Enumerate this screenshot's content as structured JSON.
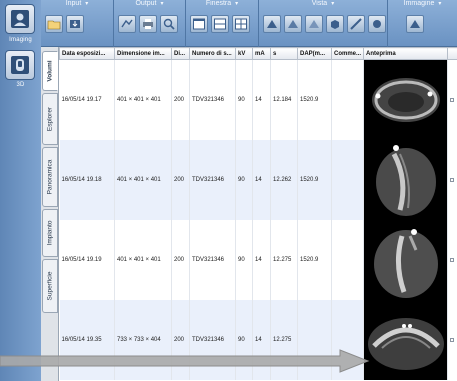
{
  "sidebar": {
    "items": [
      {
        "label": "Imaging",
        "icon": "imaging-icon"
      },
      {
        "label": "3D",
        "icon": "3d-view-icon"
      }
    ]
  },
  "toolbar": {
    "groups": [
      {
        "title": "Input"
      },
      {
        "title": "Output"
      },
      {
        "title": "Finestra"
      },
      {
        "title": "Vista"
      },
      {
        "title": "Immagine"
      }
    ]
  },
  "vtabs": [
    "Volumi",
    "Esplorer",
    "Panoramica",
    "Impianto",
    "Superficie"
  ],
  "table": {
    "columns": [
      "Data esposizi...",
      "Dimensione im...",
      "Di...",
      "Numero di s...",
      "kV",
      "mA",
      "s",
      "DAP(m...",
      "Comme...",
      "Anteprima"
    ],
    "rows": [
      [
        "16/05/14 19.17",
        "401 × 401 × 401",
        "200",
        "TDV321346",
        "90",
        "14",
        "12.184",
        "1520.9",
        ""
      ],
      [
        "16/05/14 19.18",
        "401 × 401 × 401",
        "200",
        "TDV321346",
        "90",
        "14",
        "12.262",
        "1520.9",
        ""
      ],
      [
        "16/05/14 19.19",
        "401 × 401 × 401",
        "200",
        "TDV321346",
        "90",
        "14",
        "12.275",
        "1520.9",
        ""
      ],
      [
        "16/05/14 19.35",
        "733 × 733 × 404",
        "200",
        "TDV321346",
        "90",
        "14",
        "12.275",
        "",
        ""
      ]
    ]
  },
  "colors": {
    "toolbar": "#7aa0cc",
    "sidebar": "#6d93c2",
    "row_alt": "#eaf0fb",
    "preview_bg": "#000000",
    "arrow": "#a9a9a9"
  }
}
